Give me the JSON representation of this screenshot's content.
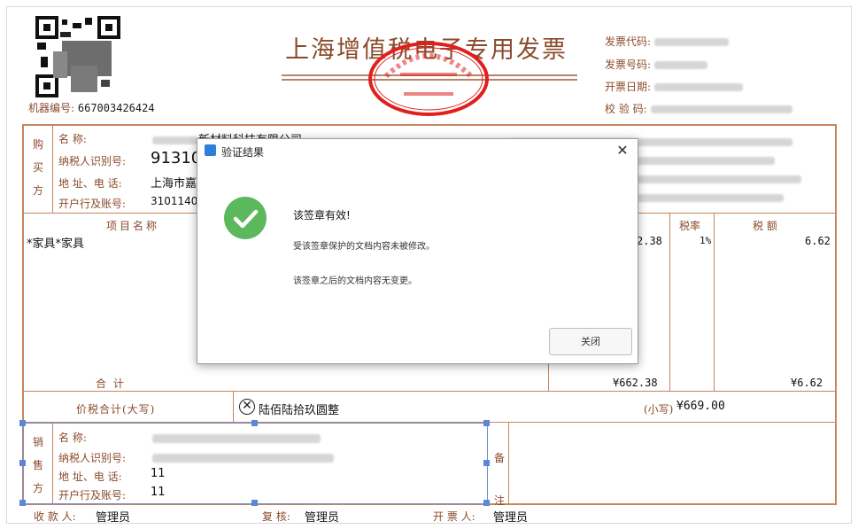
{
  "invoice": {
    "title": "上海增值税电子专用发票",
    "machine_label": "机器编号:",
    "machine_no": "667003426424",
    "meta_labels": [
      "发票代码:",
      "发票号码:",
      "开票日期:",
      "校 验 码:"
    ],
    "buyer": {
      "side_label": [
        "购",
        "买",
        "方"
      ],
      "name_label": "名      称:",
      "name_value": "新材料科技有限公司",
      "tax_label": "纳税人识别号:",
      "tax_value": "91310",
      "addr_label": "地 址、电 话:",
      "addr_value": "上海市嘉",
      "bank_label": "开户行及账号:",
      "bank_value": "31011400"
    },
    "item_header": "项目名称",
    "item_name": "*家具*家具",
    "rate_header": "税率",
    "tax_header": "税    额",
    "amount_value": "2.38",
    "rate_value": "1%",
    "tax_value": "6.62",
    "total_label": "合      计",
    "total_amount": "¥662.38",
    "total_tax": "¥6.62",
    "grand_label": "价税合计(大写)",
    "grand_upper": "陆佰陆拾玖圆整",
    "grand_small_label": "(小写)",
    "grand_small": "¥669.00",
    "seller": {
      "side_label": [
        "销",
        "售",
        "方"
      ],
      "name_label": "名      称:",
      "tax_label": "纳税人识别号:",
      "addr_label": "地 址、电 话:",
      "addr_value": "11",
      "bank_label": "开户行及账号:",
      "bank_value": "11"
    },
    "remark_label": [
      "备",
      "注"
    ],
    "payee_label": "收 款 人:",
    "payee": "管理员",
    "reviewer_label": "复    核:",
    "reviewer": "管理员",
    "drawer_label": "开 票 人:",
    "drawer": "管理员"
  },
  "dialog": {
    "title": "验证结果",
    "headline": "该签章有效!",
    "line1": "受该签章保护的文档内容未被修改。",
    "line2": "该签章之后的文档内容无变更。",
    "close_button": "关闭",
    "close_icon": "close-icon"
  },
  "colors": {
    "accent": "#8b4a2b",
    "line": "#c7845f",
    "ok": "#5cb85c",
    "seal": "#e0201e",
    "selection": "#5b87d6"
  }
}
